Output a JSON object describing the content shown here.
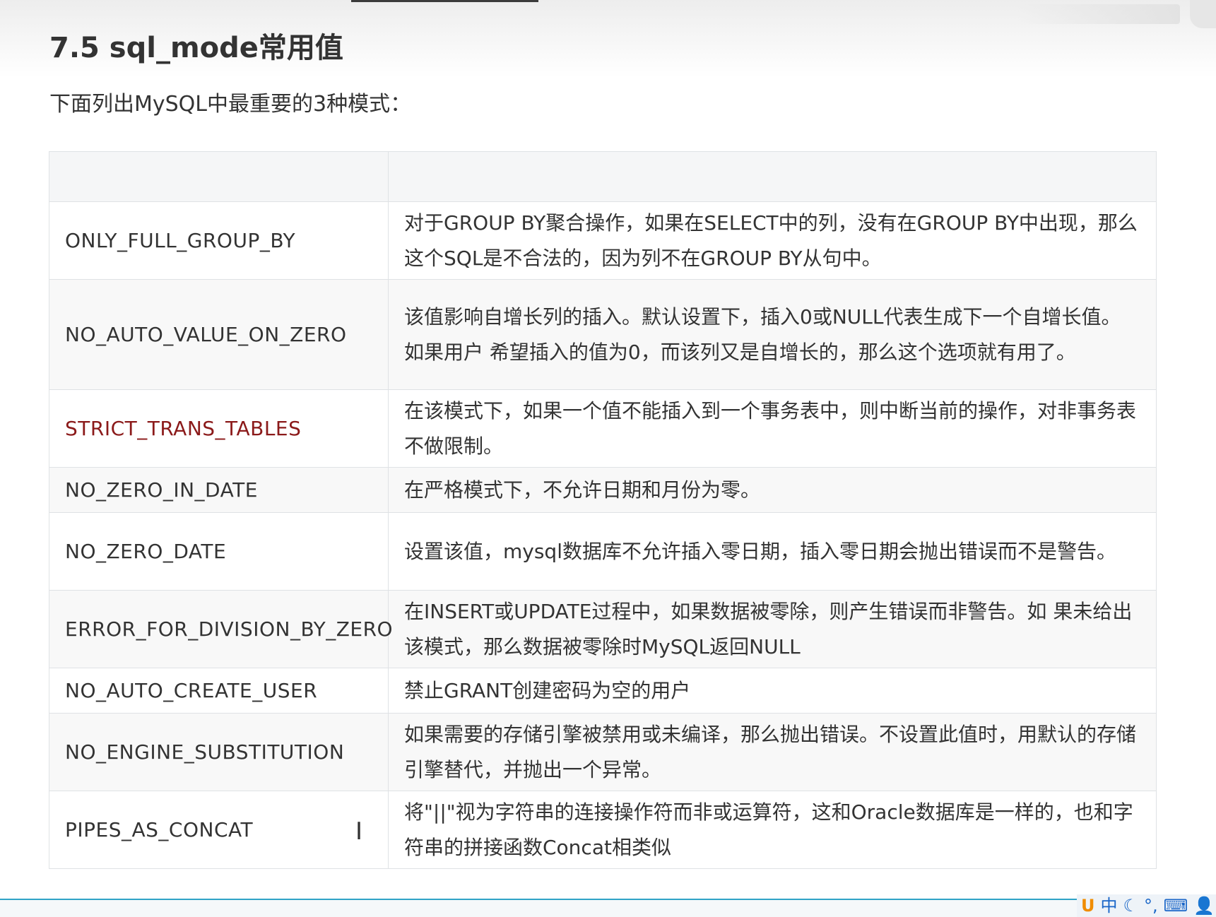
{
  "section": {
    "heading": "7.5 sql_mode常用值",
    "intro": "下面列出MySQL中最重要的3种模式："
  },
  "table": {
    "header": [
      "",
      ""
    ],
    "rows": [
      {
        "name": "ONLY_FULL_GROUP_BY",
        "desc": "对于GROUP BY聚合操作，如果在SELECT中的列，没有在GROUP BY中出现，那么这个SQL是不合法的，因为列不在GROUP BY从句中。"
      },
      {
        "name": "NO_AUTO_VALUE_ON_ZERO",
        "desc": "该值影响自增长列的插入。默认设置下，插入0或NULL代表生成下一个自增长值。如果用户 希望插入的值为0，而该列又是自增长的，那么这个选项就有用了。"
      },
      {
        "name": "STRICT_TRANS_TABLES",
        "desc": "在该模式下，如果一个值不能插入到一个事务表中，则中断当前的操作，对非事务表不做限制。"
      },
      {
        "name": "NO_ZERO_IN_DATE",
        "desc": "在严格模式下，不允许日期和月份为零。"
      },
      {
        "name": "NO_ZERO_DATE",
        "desc": "设置该值，mysql数据库不允许插入零日期，插入零日期会抛出错误而不是警告。"
      },
      {
        "name": "ERROR_FOR_DIVISION_BY_ZERO",
        "desc": "在INSERT或UPDATE过程中，如果数据被零除，则产生错误而非警告。如 果未给出该模式，那么数据被零除时MySQL返回NULL"
      },
      {
        "name": "NO_AUTO_CREATE_USER",
        "desc": "禁止GRANT创建密码为空的用户"
      },
      {
        "name": "NO_ENGINE_SUBSTITUTION",
        "desc": "如果需要的存储引擎被禁用或未编译，那么抛出错误。不设置此值时，用默认的存储引擎替代，并抛出一个异常。"
      },
      {
        "name": "PIPES_AS_CONCAT",
        "desc": "将\"||\"视为字符串的连接操作符而非或运算符，这和Oracle数据库是一样的，也和字符串的拼接函数Concat相类似"
      }
    ],
    "highlight_row_color": "#8b1a1a"
  },
  "taskbar": {
    "ime_items": [
      "中",
      "☾",
      "°,",
      "⌨",
      "👤"
    ],
    "ime_logo": "U",
    "accent_color": "#2fa3c7"
  },
  "cursor": {
    "glyph": "I"
  }
}
